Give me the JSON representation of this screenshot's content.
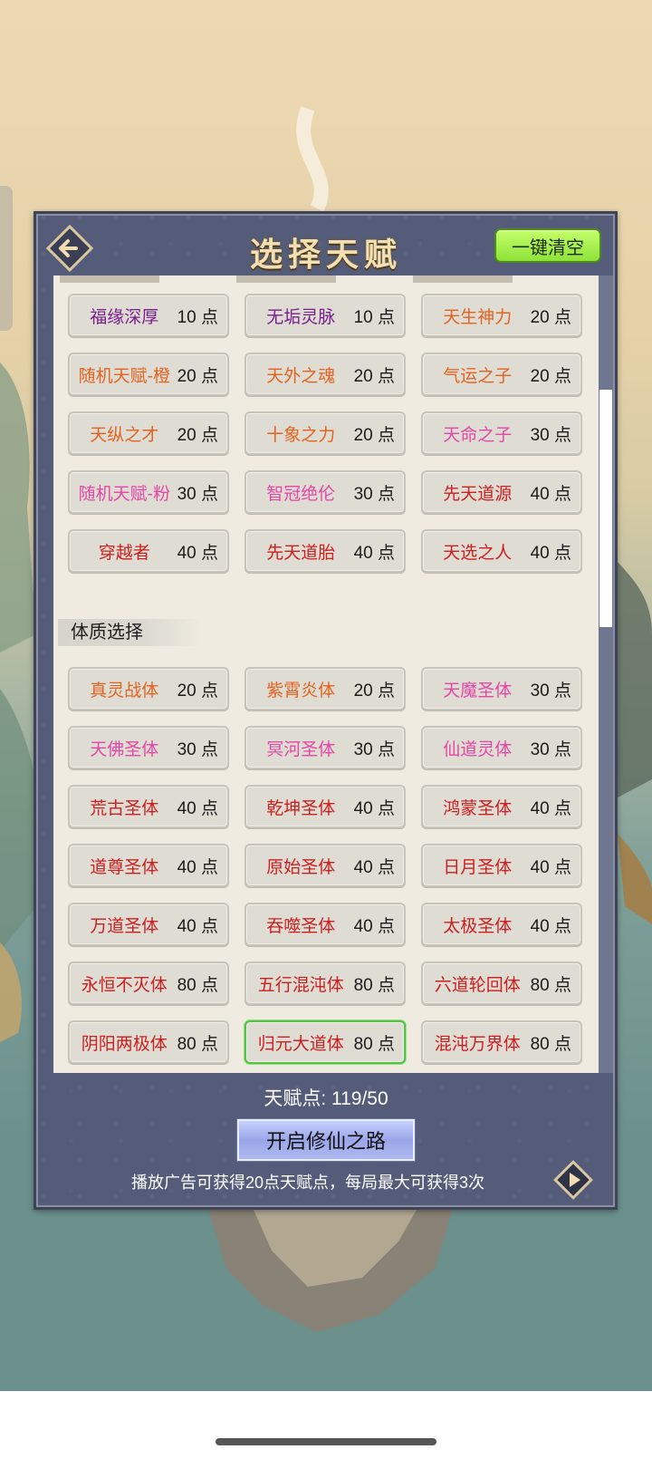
{
  "header": {
    "title": "选择天赋",
    "clear_label": "一键清空"
  },
  "talents": [
    {
      "name": "福缘深厚",
      "points": "10 点",
      "color": "#7a1f8e"
    },
    {
      "name": "无垢灵脉",
      "points": "10 点",
      "color": "#7a1f8e"
    },
    {
      "name": "天生神力",
      "points": "20 点",
      "color": "#e4631f"
    },
    {
      "name": "随机天赋-橙",
      "points": "20 点",
      "color": "#e4631f"
    },
    {
      "name": "天外之魂",
      "points": "20 点",
      "color": "#e4631f"
    },
    {
      "name": "气运之子",
      "points": "20 点",
      "color": "#e4631f"
    },
    {
      "name": "天纵之才",
      "points": "20 点",
      "color": "#e4631f"
    },
    {
      "name": "十象之力",
      "points": "20 点",
      "color": "#e4631f"
    },
    {
      "name": "天命之子",
      "points": "30 点",
      "color": "#e447a6"
    },
    {
      "name": "随机天赋-粉",
      "points": "30 点",
      "color": "#e447a6"
    },
    {
      "name": "智冠绝伦",
      "points": "30 点",
      "color": "#e447a6"
    },
    {
      "name": "先天道源",
      "points": "40 点",
      "color": "#cc1f1f"
    },
    {
      "name": "穿越者",
      "points": "40 点",
      "color": "#cc1f1f"
    },
    {
      "name": "先天道胎",
      "points": "40 点",
      "color": "#cc1f1f"
    },
    {
      "name": "天选之人",
      "points": "40 点",
      "color": "#cc1f1f"
    }
  ],
  "physique_section": {
    "label": "体质选择"
  },
  "physiques": [
    {
      "name": "真灵战体",
      "points": "20 点",
      "color": "#e4631f"
    },
    {
      "name": "紫霄炎体",
      "points": "20 点",
      "color": "#e4631f"
    },
    {
      "name": "天魔圣体",
      "points": "30 点",
      "color": "#e447a6"
    },
    {
      "name": "天佛圣体",
      "points": "30 点",
      "color": "#e447a6"
    },
    {
      "name": "冥河圣体",
      "points": "30 点",
      "color": "#e447a6"
    },
    {
      "name": "仙道灵体",
      "points": "30 点",
      "color": "#e447a6"
    },
    {
      "name": "荒古圣体",
      "points": "40 点",
      "color": "#cc1f1f"
    },
    {
      "name": "乾坤圣体",
      "points": "40 点",
      "color": "#cc1f1f"
    },
    {
      "name": "鸿蒙圣体",
      "points": "40 点",
      "color": "#cc1f1f"
    },
    {
      "name": "道尊圣体",
      "points": "40 点",
      "color": "#cc1f1f"
    },
    {
      "name": "原始圣体",
      "points": "40 点",
      "color": "#cc1f1f"
    },
    {
      "name": "日月圣体",
      "points": "40 点",
      "color": "#cc1f1f"
    },
    {
      "name": "万道圣体",
      "points": "40 点",
      "color": "#cc1f1f"
    },
    {
      "name": "吞噬圣体",
      "points": "40 点",
      "color": "#cc1f1f"
    },
    {
      "name": "太极圣体",
      "points": "40 点",
      "color": "#cc1f1f"
    },
    {
      "name": "永恒不灭体",
      "points": "80 点",
      "color": "#cc1f1f"
    },
    {
      "name": "五行混沌体",
      "points": "80 点",
      "color": "#cc1f1f"
    },
    {
      "name": "六道轮回体",
      "points": "80 点",
      "color": "#cc1f1f"
    },
    {
      "name": "阴阳两极体",
      "points": "80 点",
      "color": "#cc1f1f"
    },
    {
      "name": "归元大道体",
      "points": "80 点",
      "color": "#cc1f1f",
      "selected": true
    },
    {
      "name": "混沌万界体",
      "points": "80 点",
      "color": "#cc1f1f"
    }
  ],
  "footer": {
    "talent_points": "天赋点: 119/50",
    "start_label": "开启修仙之路",
    "ad_hint": "播放广告可获得20点天赋点，每局最大可获得3次"
  },
  "icons": {
    "back": "back-arrow-icon",
    "play": "play-triangle-icon"
  }
}
